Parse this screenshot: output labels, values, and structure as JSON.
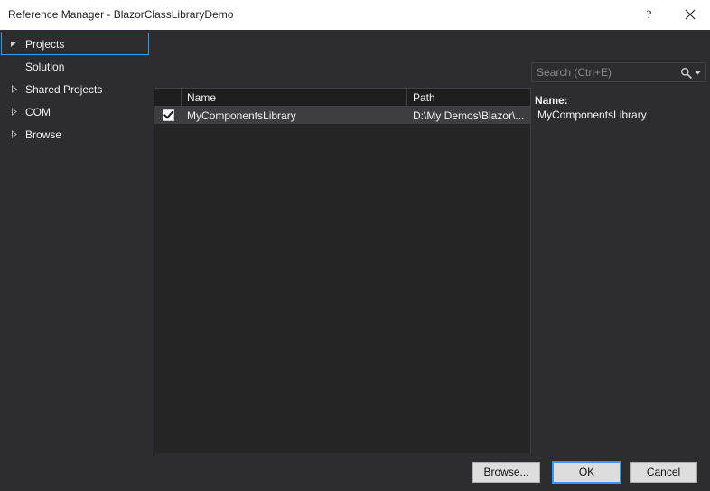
{
  "window": {
    "title": "Reference Manager - BlazorClassLibraryDemo",
    "help_button": "?",
    "close_button": "×"
  },
  "sidebar": {
    "items": [
      {
        "label": "Projects",
        "expander": "expanded",
        "selected": true,
        "indent": 0
      },
      {
        "label": "Solution",
        "expander": "none",
        "selected": false,
        "indent": 1
      },
      {
        "label": "Shared Projects",
        "expander": "collapsed",
        "selected": false,
        "indent": 0
      },
      {
        "label": "COM",
        "expander": "collapsed",
        "selected": false,
        "indent": 0
      },
      {
        "label": "Browse",
        "expander": "collapsed",
        "selected": false,
        "indent": 0
      }
    ]
  },
  "search": {
    "placeholder": "Search (Ctrl+E)",
    "value": "",
    "icon": "search-icon",
    "dropdown_icon": "chevron-down-icon"
  },
  "list": {
    "columns": [
      "",
      "Name",
      "Path"
    ],
    "rows": [
      {
        "checked": true,
        "name": "MyComponentsLibrary",
        "path": "D:\\My Demos\\Blazor\\...",
        "selected": true
      }
    ]
  },
  "details": {
    "name_label": "Name:",
    "name_value": "MyComponentsLibrary"
  },
  "footer": {
    "browse_label": "Browse...",
    "ok_label": "OK",
    "cancel_label": "Cancel"
  },
  "colors": {
    "dialog_background": "#2d2d30",
    "list_background": "#252526",
    "header_background": "#1e1e1e",
    "row_selected": "#3e3e40",
    "accent": "#3399ff",
    "titlebar_background": "#ffffff",
    "text": "#f1f1f1",
    "border": "#3f3f46"
  }
}
